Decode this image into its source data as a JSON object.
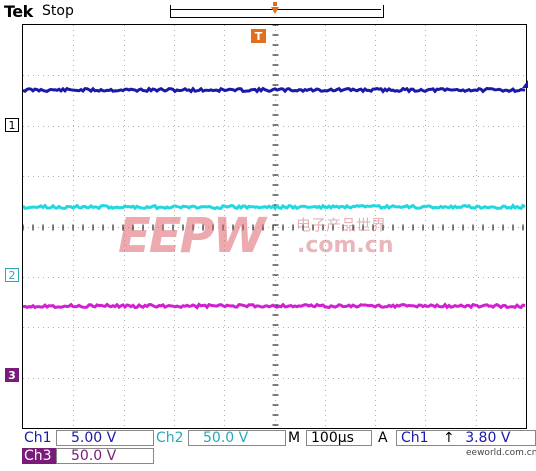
{
  "header": {
    "brand": "Tek",
    "status": "Stop",
    "trigger_position_icon": "trigger-position-icon",
    "trigger_marker_label": "T"
  },
  "channels": [
    {
      "id": "ch1",
      "marker": "1",
      "color": "#1a1aa8"
    },
    {
      "id": "ch2",
      "marker": "2",
      "color": "#2aa8b8"
    },
    {
      "id": "ch3",
      "marker": "3",
      "color": "#c020c0"
    }
  ],
  "readouts": {
    "ch1_label": "Ch1",
    "ch1_scale": "5.00 V",
    "ch2_label": "Ch2",
    "ch2_scale": "50.0 V",
    "m_label": "M",
    "timebase": "100µs",
    "a_label": "A",
    "trigger_source": "Ch1",
    "trigger_slope_icon": "rising-edge-icon",
    "trigger_level": "3.80 V",
    "ch3_label": "Ch3",
    "ch3_scale": "50.0 V"
  },
  "watermark": {
    "logo": "EEPW",
    "chinese": "电子产品世界",
    "url": ".com.cn"
  },
  "corner_watermark": {
    "text": "eeworld.com.cn"
  }
}
